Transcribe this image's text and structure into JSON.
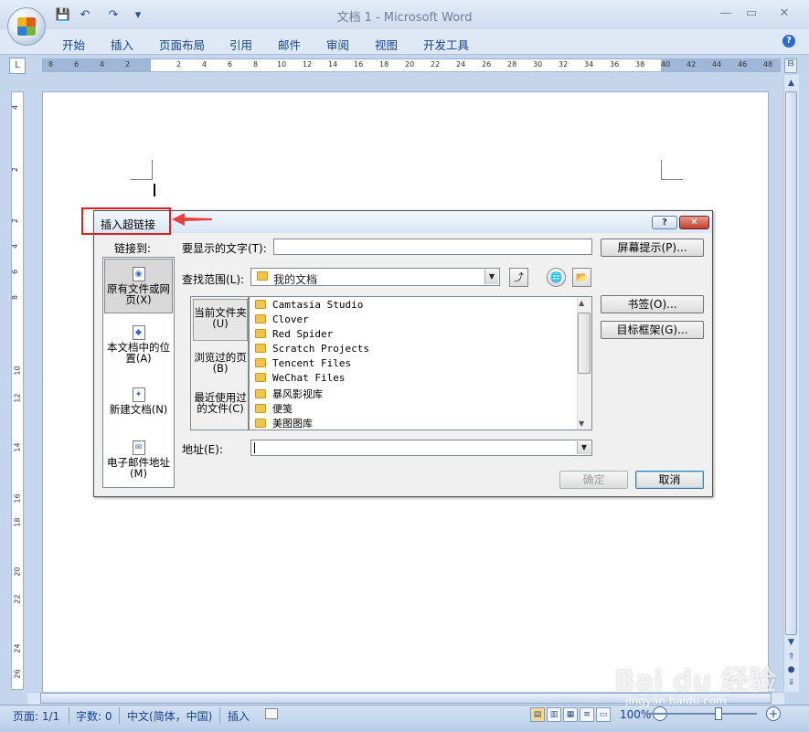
{
  "titlebar": {
    "title": "文档 1 - Microsoft Word",
    "minimize": "▭",
    "restore": "▭",
    "close": "✕"
  },
  "qat": {
    "save": "💾",
    "undo": "↶",
    "redo": "↷",
    "customize": "▾"
  },
  "ribbon": {
    "tabs": [
      "开始",
      "插入",
      "页面布局",
      "引用",
      "邮件",
      "审阅",
      "视图",
      "开发工具"
    ],
    "help": "?"
  },
  "ruler": {
    "corner": "L",
    "left_ticks": [
      "8",
      "6",
      "4",
      "2"
    ],
    "right_ticks": [
      "2",
      "4",
      "6",
      "8",
      "10",
      "12",
      "14",
      "16",
      "18",
      "20",
      "22",
      "24",
      "26",
      "28",
      "30",
      "32",
      "34",
      "36",
      "38",
      "40",
      "42",
      "44",
      "46",
      "48"
    ],
    "vertical_ticks": [
      "4",
      "2",
      "2",
      "4",
      "6",
      "8",
      "10",
      "12",
      "14",
      "16",
      "18",
      "20",
      "22",
      "24",
      "26"
    ]
  },
  "dialog": {
    "title": "插入超链接",
    "help_btn": "?",
    "close_btn": "✕",
    "link_to_label": "链接到:",
    "link_to_items": [
      {
        "label": "原有文件或网页(X)",
        "selected": true
      },
      {
        "label": "本文档中的位置(A)",
        "selected": false
      },
      {
        "label": "新建文档(N)",
        "selected": false
      },
      {
        "label": "电子邮件地址(M)",
        "selected": false
      }
    ],
    "text_to_display_label": "要显示的文字(T):",
    "text_to_display_value": "",
    "screentip_btn": "屏幕提示(P)...",
    "look_in_label": "查找范围(L):",
    "look_in_value": "我的文档",
    "side_items": [
      {
        "label": "当前文件夹(U)",
        "selected": true
      },
      {
        "label": "浏览过的页(B)",
        "selected": false
      },
      {
        "label": "最近使用过的文件(C)",
        "selected": false
      }
    ],
    "files": [
      "Camtasia Studio",
      "Clover",
      "Red Spider",
      "Scratch Projects",
      "Tencent Files",
      "WeChat Files",
      "暴风影视库",
      "便笺",
      "美图图库"
    ],
    "bookmark_btn": "书签(O)...",
    "target_frame_btn": "目标框架(G)...",
    "address_label": "地址(E):",
    "address_value": "",
    "ok_btn": "确定",
    "cancel_btn": "取消"
  },
  "statusbar": {
    "page": "页面: 1/1",
    "words": "字数: 0",
    "language": "中文(简体，中国)",
    "insert": "插入",
    "zoom": "100%",
    "zoom_minus": "−",
    "zoom_plus": "+"
  },
  "watermark": {
    "brand": "Bai du 经验",
    "url": "jingyan.baidu.com"
  },
  "colors": {
    "annotation_red": "#e02020",
    "ribbon_text": "#15428b"
  }
}
